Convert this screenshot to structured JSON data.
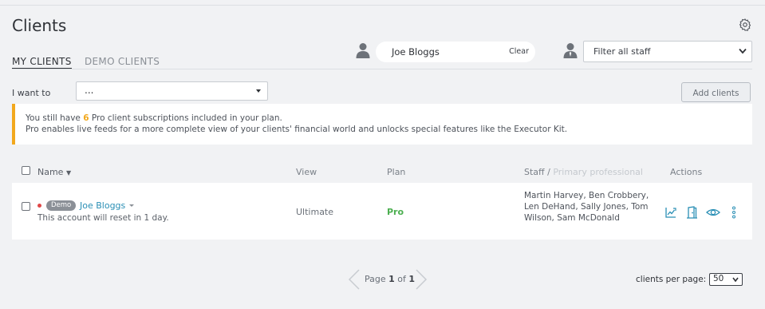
{
  "page": {
    "title": "Clients"
  },
  "tabs": [
    {
      "label": "MY CLIENTS",
      "active": true
    },
    {
      "label": "DEMO CLIENTS",
      "active": false
    }
  ],
  "client_search": {
    "value": "Joe Bloggs",
    "clear_label": "Clear"
  },
  "staff_filter": {
    "value": "Filter all staff"
  },
  "bulk_action": {
    "label": "I want to",
    "value": "..."
  },
  "add_clients_label": "Add clients",
  "notice": {
    "line1_prefix": "You still have ",
    "count": "6",
    "line1_suffix": " Pro client subscriptions included in your plan.",
    "line2": "Pro enables live feeds for a more complete view of your clients' financial world and unlocks special features like the Executor Kit."
  },
  "table": {
    "headers": {
      "name": "Name",
      "view": "View",
      "plan": "Plan",
      "staff": "Staff /",
      "staff_secondary": "Primary professional",
      "actions": "Actions"
    },
    "rows": [
      {
        "badge": "Demo",
        "name": "Joe Bloggs",
        "subtext": "This account will reset in 1 day.",
        "view": "Ultimate",
        "plan": "Pro",
        "staff": "Martin Harvey, Ben Crobbery, Len DeHand, Sally Jones, Tom Wilson, Sam McDonald",
        "actions": [
          "chart-edit-icon",
          "door-icon",
          "eye-icon",
          "more-vertical-icon"
        ]
      }
    ]
  },
  "pagination": {
    "prefix": "Page",
    "current": "1",
    "of": "of",
    "total": "1"
  },
  "per_page": {
    "label": "clients per page:",
    "value": "50"
  },
  "colors": {
    "accent_link": "#2a8fb5",
    "warning": "#f2a81d",
    "plan_pro": "#4caf50",
    "status_dot": "#e04848",
    "background": "#f1f2f4"
  }
}
